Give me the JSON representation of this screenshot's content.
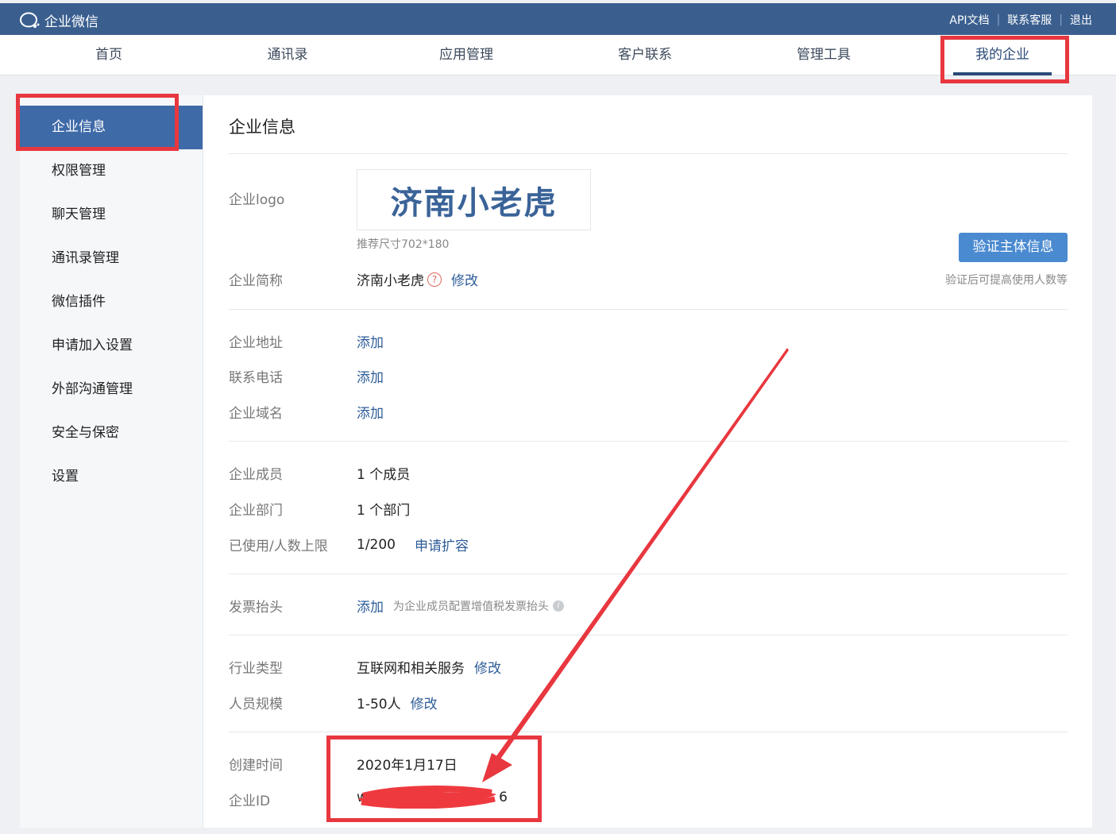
{
  "topbar": {
    "brand": "企业微信",
    "links": [
      "API文档",
      "联系客服",
      "退出"
    ]
  },
  "nav": {
    "tabs": [
      "首页",
      "通讯录",
      "应用管理",
      "客户联系",
      "管理工具",
      "我的企业"
    ],
    "active": "我的企业"
  },
  "sidebar": {
    "items": [
      "企业信息",
      "权限管理",
      "聊天管理",
      "通讯录管理",
      "微信插件",
      "申请加入设置",
      "外部沟通管理",
      "安全与保密",
      "设置"
    ],
    "active": "企业信息"
  },
  "main": {
    "title": "企业信息",
    "logo_label": "企业logo",
    "logo_text": "济南小老虎",
    "logo_hint": "推荐尺寸702*180",
    "verify_button": "验证主体信息",
    "verify_note": "验证后可提高使用人数等",
    "short_name_label": "企业简称",
    "short_name": "济南小老虎",
    "short_name_help": "?",
    "modify": "修改",
    "address_label": "企业地址",
    "phone_label": "联系电话",
    "domain_label": "企业域名",
    "add": "添加",
    "members_label": "企业成员",
    "members_value": "1 个成员",
    "departments_label": "企业部门",
    "departments_value": "1 个部门",
    "usage_label": "已使用/人数上限",
    "usage_value": "1/200",
    "expand_link": "申请扩容",
    "invoice_label": "发票抬头",
    "invoice_note": "为企业成员配置增值税发票抬头",
    "invoice_info": "i",
    "industry_label": "行业类型",
    "industry_value": "互联网和相关服务",
    "scale_label": "人员规模",
    "scale_value": "1-50人",
    "created_label": "创建时间",
    "created_value": "2020年1月17日",
    "corp_id_label": "企业ID",
    "corp_id_visible_start": "ww",
    "corp_id_visible_end": "6"
  },
  "colors": {
    "header_bg": "#3a5f8f",
    "active_sidebar": "#3f6aa8",
    "link": "#2d5d99",
    "button": "#4a8ad0",
    "annotation_red": "#e8373f"
  }
}
